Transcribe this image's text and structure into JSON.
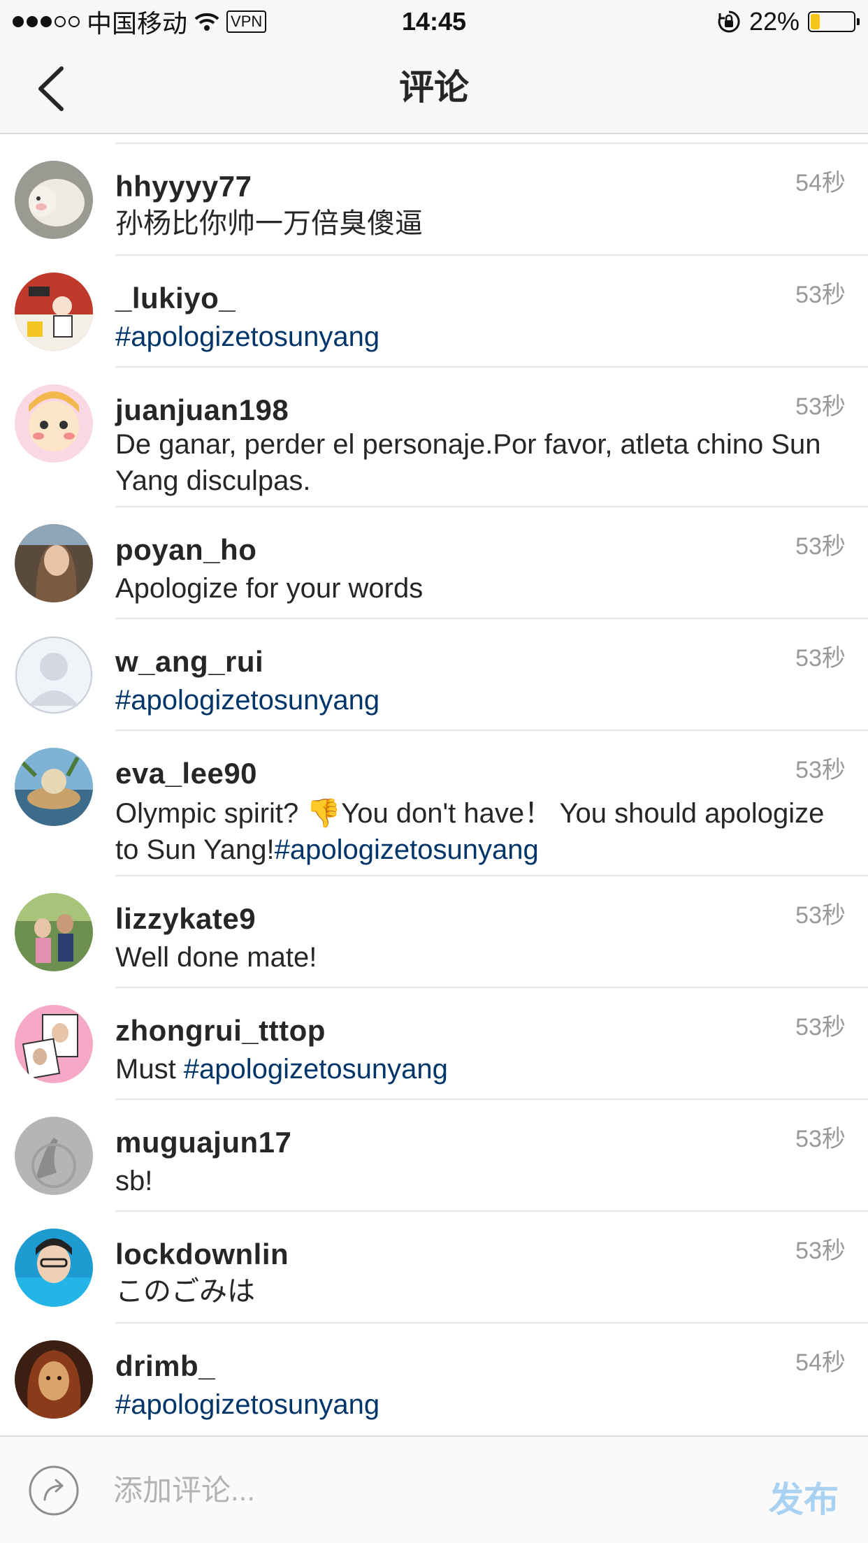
{
  "status_bar": {
    "carrier": "中国移动",
    "vpn": "VPN",
    "time": "14:45",
    "battery": "22%",
    "battery_level": 0.22
  },
  "header": {
    "title": "评论"
  },
  "comments": [
    {
      "username": "hhyyyy77",
      "time": "54秒",
      "text": "孙杨比你帅一万倍臭傻逼"
    },
    {
      "username": "_lukiyo_",
      "time": "53秒",
      "hashtag": "#apologizetosunyang"
    },
    {
      "username": "juanjuan198",
      "time": "53秒",
      "text": "De ganar, perder el personaje.Por favor, atleta chino Sun Yang disculpas."
    },
    {
      "username": "poyan_ho",
      "time": "53秒",
      "text": "Apologize for your words"
    },
    {
      "username": "w_ang_rui",
      "time": "53秒",
      "hashtag": "#apologizetosunyang"
    },
    {
      "username": "eva_lee90",
      "time": "53秒",
      "text_part1": "Olympic spirit? 👎You don't have！  You should apologize to Sun Yang!",
      "hashtag": "#apologizetosunyang"
    },
    {
      "username": "lizzykate9",
      "time": "53秒",
      "text": "Well done mate!"
    },
    {
      "username": "zhongrui_tttop",
      "time": "53秒",
      "text_part1": "Must ",
      "hashtag": "#apologizetosunyang"
    },
    {
      "username": "muguajun17",
      "time": "53秒",
      "text": "sb!"
    },
    {
      "username": "lockdownlin",
      "time": "53秒",
      "text": "このごみは"
    },
    {
      "username": "drimb_",
      "time": "54秒",
      "hashtag": "#apologizetosunyang"
    }
  ],
  "input": {
    "placeholder": "添加评论..."
  },
  "post_label": "发布",
  "colors": {
    "hashtag": "#003569",
    "post_button": "#a9d1f2",
    "time": "#999999"
  }
}
